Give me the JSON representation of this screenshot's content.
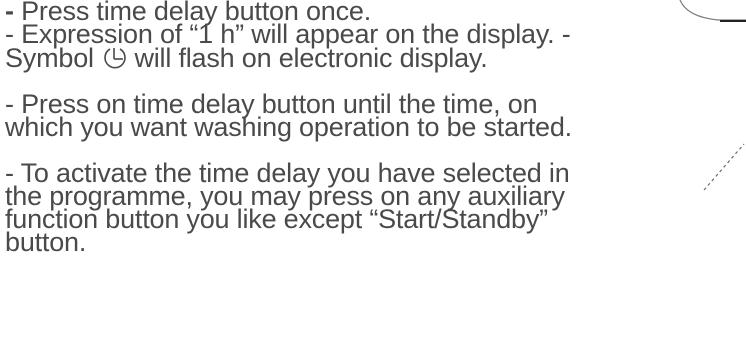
{
  "instructions": {
    "step1": {
      "dash": "-",
      "text": " Press time delay button once."
    },
    "step2": {
      "line1": "- Expression of “1 h” will appear on the display. -",
      "line2_prefix": "Symbol",
      "line2_suffix": " will flash on electronic display.",
      "icon": "timer-delay-icon"
    },
    "step3": {
      "line1": "- Press on time delay button until the time, on",
      "line2": "which you want washing operation to be started."
    },
    "step4": {
      "line1": "- To activate the time delay you have selected in",
      "line2": "the programme, you may press on any auxiliary",
      "line3": "function button you like except “Start/Standby”",
      "line4": "button."
    }
  }
}
